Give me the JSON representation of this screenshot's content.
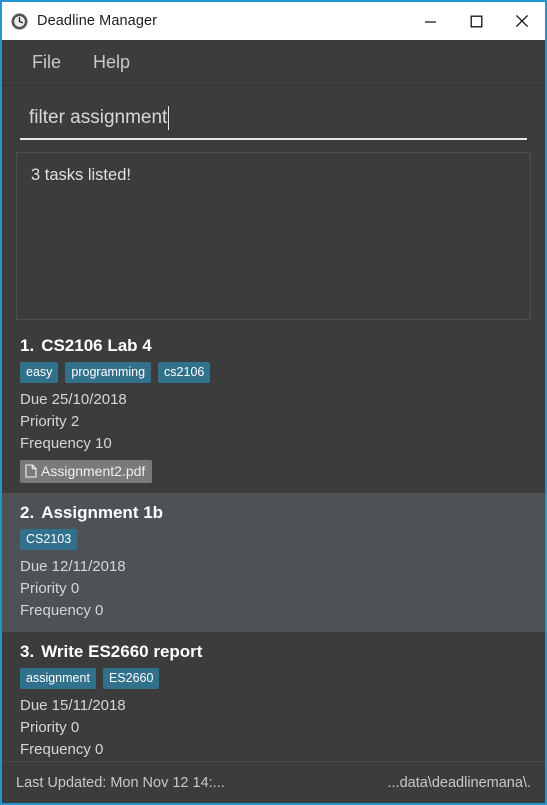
{
  "window": {
    "title": "Deadline Manager",
    "app_icon": "clock-icon",
    "controls": {
      "minimize": "—",
      "maximize": "□",
      "close": "✕"
    },
    "accent_border": "#2196cf"
  },
  "menubar": {
    "items": [
      {
        "label": "File"
      },
      {
        "label": "Help"
      }
    ]
  },
  "filter": {
    "value": "filter assignment",
    "placeholder": ""
  },
  "result": {
    "text": "3 tasks listed!"
  },
  "tasks": [
    {
      "index": "1.",
      "title": "CS2106 Lab 4",
      "tags": [
        "easy",
        "programming",
        "cs2106"
      ],
      "due": "Due 25/10/2018",
      "priority": "Priority 2",
      "frequency": "Frequency 10",
      "attachments": [
        "Assignment2.pdf"
      ],
      "highlighted": false
    },
    {
      "index": "2.",
      "title": "Assignment 1b",
      "tags": [
        "CS2103"
      ],
      "due": "Due 12/11/2018",
      "priority": "Priority 0",
      "frequency": "Frequency 0",
      "attachments": [],
      "highlighted": true
    },
    {
      "index": "3.",
      "title": "Write ES2660 report",
      "tags": [
        "assignment",
        "ES2660"
      ],
      "due": "Due 15/11/2018",
      "priority": "Priority 0",
      "frequency": "Frequency 0",
      "attachments": [],
      "highlighted": false
    }
  ],
  "statusbar": {
    "left": "Last Updated: Mon Nov 12 14:...",
    "right": "...data\\deadlinemana\\."
  },
  "colors": {
    "tag_bg": "#31718c",
    "attachment_bg": "#7a7a7a",
    "app_bg": "#3c3c3c",
    "highlight_bg": "#4d5256"
  }
}
